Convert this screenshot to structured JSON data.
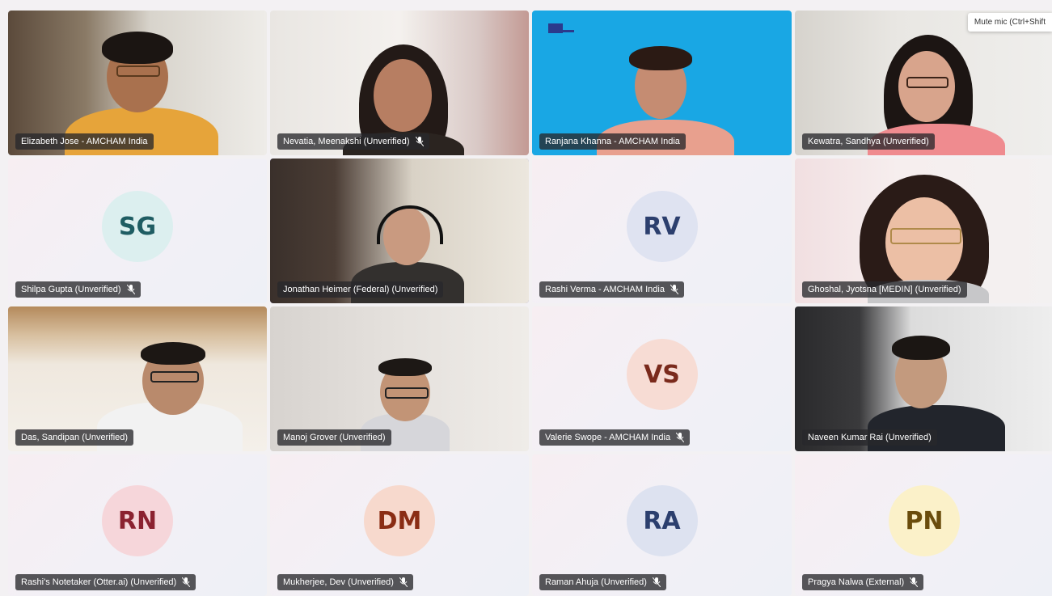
{
  "tooltip": "Mute mic (Ctrl+Shift",
  "colors": {
    "active_border": "#6f69c9",
    "label_bg": "#28282c",
    "tile_bg": "#f3f0f4"
  },
  "participants": [
    {
      "name": "Elizabeth Jose - AMCHAM India",
      "video": true,
      "muted": false
    },
    {
      "name": "Nevatia, Meenakshi (Unverified)",
      "video": true,
      "muted": true
    },
    {
      "name": "Ranjana Khanna - AMCHAM India",
      "video": true,
      "muted": false
    },
    {
      "name": "Kewatra, Sandhya (Unverified)",
      "video": true,
      "muted": false
    },
    {
      "name": "Shilpa Gupta (Unverified)",
      "video": false,
      "initials": "SG",
      "avatar_bg": "#dcefef",
      "avatar_fg": "#1f5d63",
      "muted": true
    },
    {
      "name": "Jonathan Heimer (Federal) (Unverified)",
      "video": true,
      "muted": false,
      "active_speaker": true
    },
    {
      "name": "Rashi Verma - AMCHAM India",
      "video": false,
      "initials": "RV",
      "avatar_bg": "#dfe3f1",
      "avatar_fg": "#2c3f6e",
      "muted": true
    },
    {
      "name": "Ghoshal, Jyotsna [MEDIN] (Unverified)",
      "video": true,
      "muted": false
    },
    {
      "name": "Das, Sandipan (Unverified)",
      "video": true,
      "muted": false
    },
    {
      "name": "Manoj Grover (Unverified)",
      "video": true,
      "muted": false
    },
    {
      "name": "Valerie Swope - AMCHAM India",
      "video": false,
      "initials": "VS",
      "avatar_bg": "#f7dcd4",
      "avatar_fg": "#7a2a1c",
      "muted": true
    },
    {
      "name": "Naveen Kumar Rai (Unverified)",
      "video": true,
      "muted": false
    },
    {
      "name": "Rashi's Notetaker (Otter.ai) (Unverified)",
      "video": false,
      "initials": "RN",
      "avatar_bg": "#f6d6da",
      "avatar_fg": "#8b2230",
      "muted": true
    },
    {
      "name": "Mukherjee, Dev (Unverified)",
      "video": false,
      "initials": "DM",
      "avatar_bg": "#f7d9cd",
      "avatar_fg": "#8a2d14",
      "muted": true
    },
    {
      "name": "Raman Ahuja (Unverified)",
      "video": false,
      "initials": "RA",
      "avatar_bg": "#dde2f0",
      "avatar_fg": "#2c3f6e",
      "muted": true
    },
    {
      "name": "Pragya Nalwa (External)",
      "video": false,
      "initials": "PN",
      "avatar_bg": "#fbf1c9",
      "avatar_fg": "#6a4c0c",
      "muted": true
    }
  ]
}
